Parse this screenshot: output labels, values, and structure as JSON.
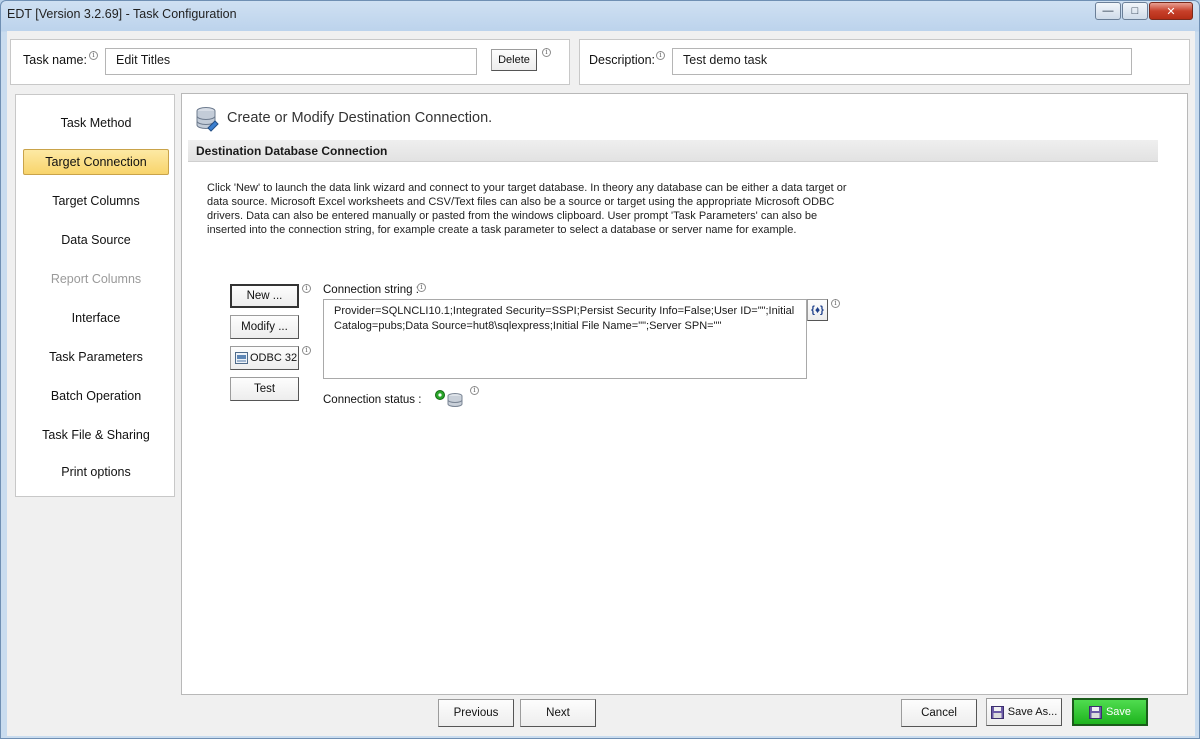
{
  "window": {
    "title": "EDT [Version 3.2.69] - Task Configuration",
    "controls": {
      "minimize": "—",
      "maximize": "□",
      "close": "✕"
    }
  },
  "header": {
    "task_name_label": "Task name:",
    "task_name_value": "Edit Titles",
    "delete_label": "Delete",
    "description_label": "Description:",
    "description_value": "Test demo task"
  },
  "sidebar": {
    "items": [
      {
        "label": "Task Method",
        "state": "normal"
      },
      {
        "label": "Target Connection",
        "state": "active"
      },
      {
        "label": "Target Columns",
        "state": "normal"
      },
      {
        "label": "Data Source",
        "state": "normal"
      },
      {
        "label": "Report Columns",
        "state": "disabled"
      },
      {
        "label": "Interface",
        "state": "normal"
      },
      {
        "label": "Task Parameters",
        "state": "normal"
      },
      {
        "label": "Batch Operation",
        "state": "normal"
      },
      {
        "label": "Task File & Sharing",
        "state": "normal"
      },
      {
        "label": "Print options",
        "state": "normal"
      }
    ]
  },
  "main": {
    "title": "Create or Modify Destination Connection.",
    "section_title": "Destination Database Connection",
    "description": "Click 'New' to launch the data link wizard and connect to your target database.  In theory any database can be either a data target or data source. Microsoft Excel worksheets and CSV/Text files can also be a source or target using the appropriate Microsoft ODBC drivers. Data can also be entered manually or pasted from the windows clipboard. User prompt 'Task Parameters' can also be inserted into the connection string, for example create a task parameter to select a database or server name for example.",
    "buttons": {
      "new": "New ...",
      "modify": "Modify ...",
      "odbc": "ODBC 32",
      "test": "Test"
    },
    "connection_string_label": "Connection string :",
    "connection_string_value": "Provider=SQLNCLI10.1;Integrated Security=SSPI;Persist Security Info=False;User ID=\"\";Initial Catalog=pubs;Data Source=hut8\\sqlexpress;Initial File Name=\"\";Server SPN=\"\"",
    "param_button": "{♦}",
    "connection_status_label": "Connection status :"
  },
  "footer": {
    "previous": "Previous",
    "next": "Next",
    "cancel": "Cancel",
    "save_as": "Save As...",
    "save": "Save"
  },
  "colors": {
    "active_nav": "#f8d46b",
    "save_button": "#22c022",
    "status_ok": "#2aa52a"
  }
}
